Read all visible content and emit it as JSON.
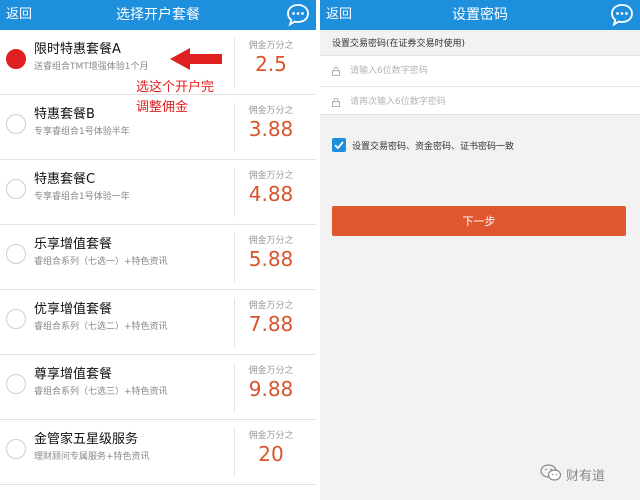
{
  "left": {
    "navbar": {
      "back": "返回",
      "title": "选择开户套餐"
    },
    "plans": [
      {
        "name": "限时特惠套餐A",
        "desc": "送睿组合TMT增强体验1个月",
        "rate_label": "佣金万分之",
        "rate": "2.5",
        "selected": true
      },
      {
        "name": "特惠套餐B",
        "desc": "专享睿组合1号体验半年",
        "rate_label": "佣金万分之",
        "rate": "3.88",
        "selected": false
      },
      {
        "name": "特惠套餐C",
        "desc": "专享睿组合1号体验一年",
        "rate_label": "佣金万分之",
        "rate": "4.88",
        "selected": false
      },
      {
        "name": "乐享增值套餐",
        "desc": "睿组合系列（七选一）+特色资讯",
        "rate_label": "佣金万分之",
        "rate": "5.88",
        "selected": false
      },
      {
        "name": "优享增值套餐",
        "desc": "睿组合系列（七选二）+特色资讯",
        "rate_label": "佣金万分之",
        "rate": "7.88",
        "selected": false
      },
      {
        "name": "尊享增值套餐",
        "desc": "睿组合系列（七选三）+特色资讯",
        "rate_label": "佣金万分之",
        "rate": "9.88",
        "selected": false
      },
      {
        "name": "金管家五星级服务",
        "desc": "理财顾问专属服务+特色资讯",
        "rate_label": "佣金万分之",
        "rate": "20",
        "selected": false
      }
    ],
    "annotation": {
      "line1": "选这个开户完",
      "line2": "调整佣金"
    }
  },
  "right": {
    "navbar": {
      "back": "返回",
      "title": "设置密码"
    },
    "section_label": "设置交易密码(在证券交易时使用)",
    "password_placeholder": "请输入6位数字密码",
    "confirm_placeholder": "请再次输入6位数字密码",
    "checkbox_label": "设置交易密码、资金密码、证书密码一致",
    "checkbox_checked": true,
    "next_button": "下一步"
  },
  "watermark": "财有道",
  "colors": {
    "navbar": "#1e8fdc",
    "accent": "#e0572f",
    "rate": "#d9542b",
    "radio_selected": "#e02020",
    "annotation": "#e02020"
  }
}
